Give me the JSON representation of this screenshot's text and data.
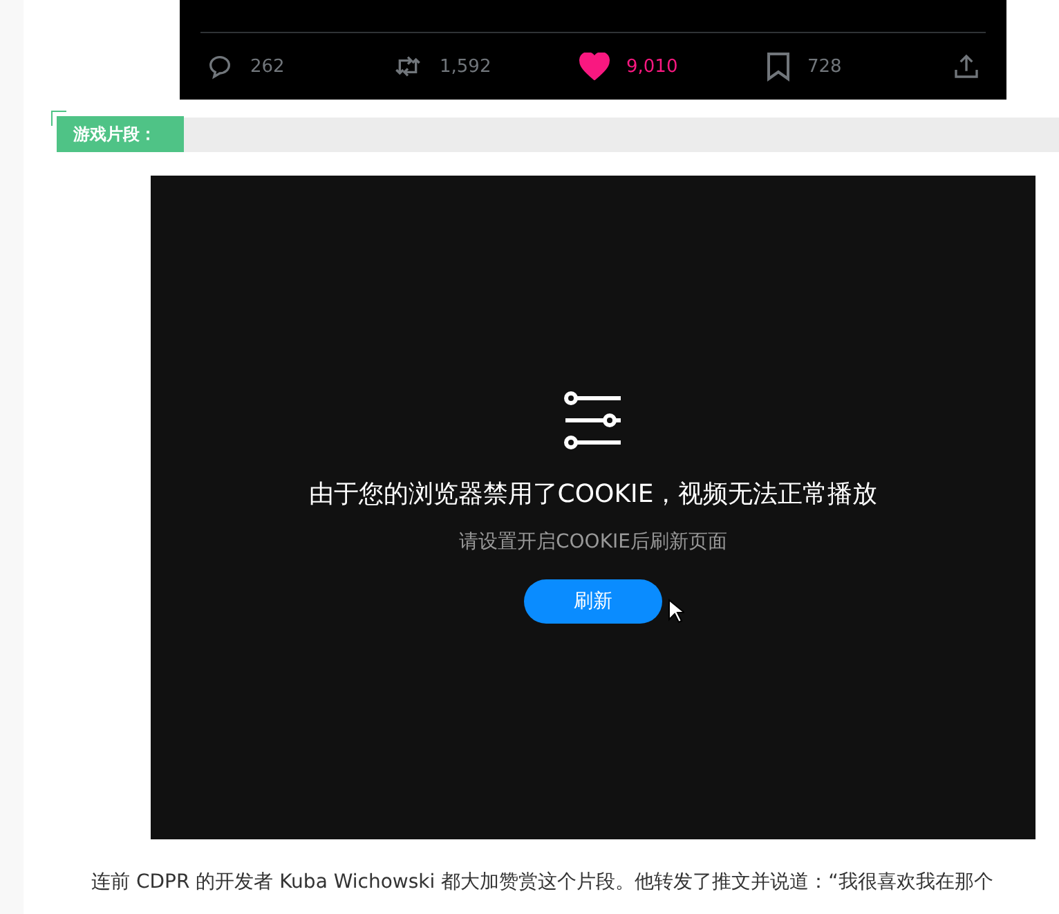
{
  "tweet_actions": [
    {
      "kind": "reply",
      "count": "262",
      "active": false
    },
    {
      "kind": "retweet",
      "count": "1,592",
      "active": false
    },
    {
      "kind": "like",
      "count": "9,010",
      "active": true
    },
    {
      "kind": "bookmark",
      "count": "728",
      "active": false
    },
    {
      "kind": "share",
      "active": false
    }
  ],
  "section": {
    "label": "游戏片段："
  },
  "video": {
    "title": "由于您的浏览器禁用了COOKIE，视频无法正常播放",
    "hint": "请设置开启COOKIE后刷新页面",
    "button": "刷新"
  },
  "paragraph": "连前 CDPR 的开发者 Kuba Wichowski 都大加赞赏这个片段。他转发了推文并说道：“我很喜欢我在那个"
}
